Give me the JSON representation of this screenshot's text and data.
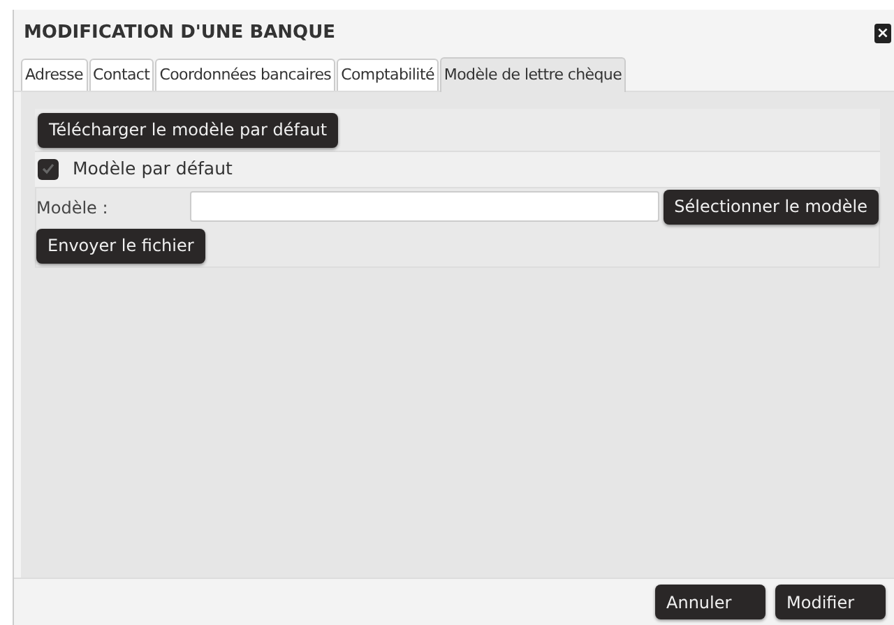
{
  "window": {
    "title": "MODIFICATION D'UNE BANQUE",
    "close": "×"
  },
  "tabs": [
    {
      "label": "Adresse",
      "selected": false
    },
    {
      "label": "Contact",
      "selected": false
    },
    {
      "label": "Coordonnées bancaires",
      "selected": false
    },
    {
      "label": "Comptabilité",
      "selected": false
    },
    {
      "label": "Modèle de lettre chèque",
      "selected": true
    }
  ],
  "download_button": "Télécharger le modèle par défaut",
  "default_model": {
    "label": "Modèle par défaut",
    "checked": true
  },
  "model_field": {
    "label": "Modèle :",
    "select_button": "Sélectionner le modèle"
  },
  "upload_button": "Envoyer le fichier",
  "buttons": [
    "Annuler",
    "Modifier"
  ]
}
